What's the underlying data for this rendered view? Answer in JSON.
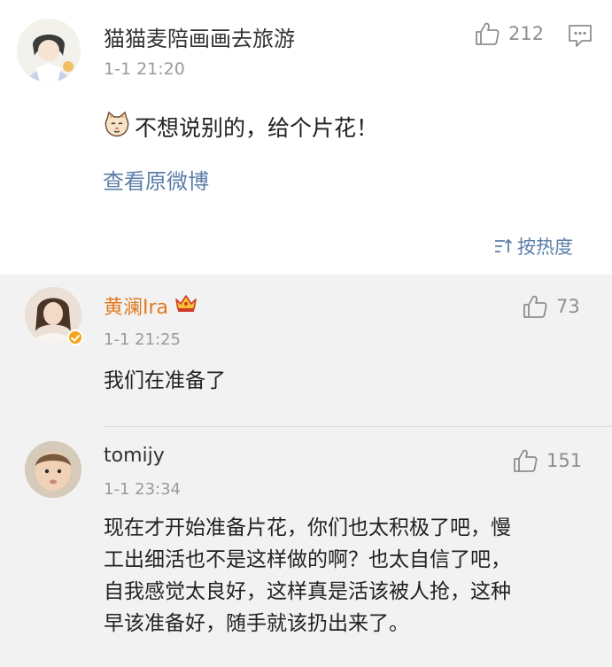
{
  "post": {
    "username": "猫猫麦陪画画去旅游",
    "time": "1-1 21:20",
    "likes": "212",
    "body_text": "不想说别的，给个片花！",
    "emoji_icon": "cat-face-emoji",
    "view_original": "查看原微博",
    "sort_label": "按热度"
  },
  "comments": [
    {
      "username": "黄澜Ira",
      "time": "1-1 21:25",
      "likes": "73",
      "text": "我们在准备了",
      "verified": true,
      "name_color": "#e07a1f"
    },
    {
      "username": "tomijy",
      "time": "1-1 23:34",
      "likes": "151",
      "lines": [
        "现在才开始准备片花，你们也太积极了吧，慢",
        "工出细活也不是这样做的啊？也太自信了吧，",
        "自我感觉太良好，这样真是活该被人抢，这种",
        "早该准备好，随手就该扔出来了。"
      ]
    }
  ],
  "colors": {
    "link": "#5b7ea8",
    "muted": "#9a9a9a",
    "vip_name": "#e07a1f",
    "comment_bg": "#f2f2f2"
  }
}
